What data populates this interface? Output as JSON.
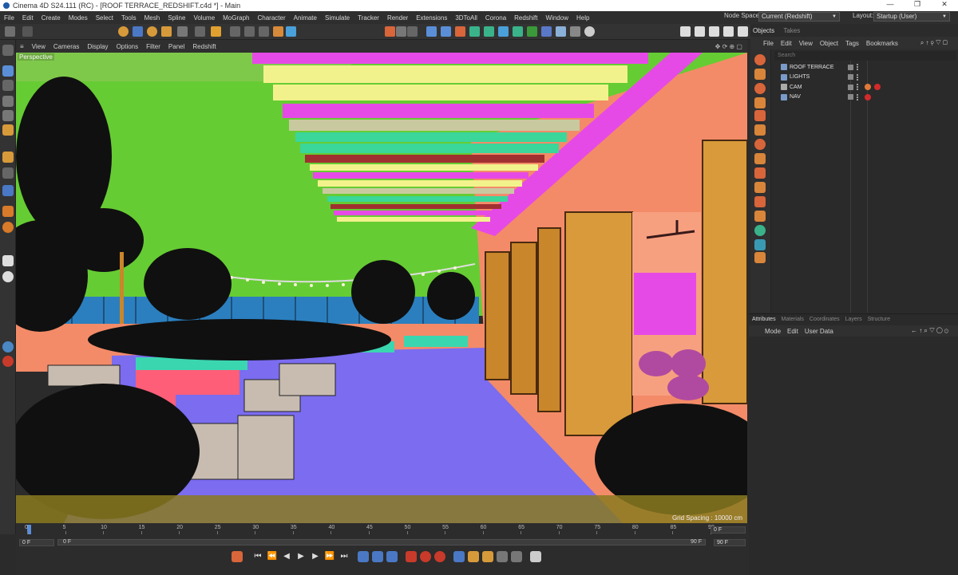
{
  "window": {
    "title": "Cinema 4D S24.111 (RC) - [ROOF TERRACE_REDSHIFT.c4d *] - Main",
    "controls": [
      "—",
      "❐",
      "✕"
    ]
  },
  "menubar": [
    "File",
    "Edit",
    "Create",
    "Modes",
    "Select",
    "Tools",
    "Mesh",
    "Spline",
    "Volume",
    "MoGraph",
    "Character",
    "Animate",
    "Simulate",
    "Tracker",
    "Render",
    "Extensions",
    "3DToAll",
    "Corona",
    "Redshift",
    "Window",
    "Help"
  ],
  "node_space": {
    "label": "Node Space:",
    "value": "Current (Redshift)"
  },
  "layout": {
    "label": "Layout:",
    "value": "Startup (User)"
  },
  "viewport": {
    "menu": [
      "View",
      "Cameras",
      "Display",
      "Options",
      "Filter",
      "Panel",
      "Redshift"
    ],
    "label": "Perspective",
    "grid_spacing": "Grid Spacing : 10000 cm"
  },
  "objects_panel": {
    "tabs": [
      "Objects",
      "Takes"
    ],
    "menu": [
      "File",
      "Edit",
      "View",
      "Object",
      "Tags",
      "Bookmarks"
    ],
    "search_placeholder": "Search",
    "items": [
      "ROOF TERRACE",
      "LIGHTS",
      "CAM",
      "NAV"
    ]
  },
  "attributes_panel": {
    "tabs": [
      "Attributes",
      "Materials",
      "Coordinates",
      "Layers",
      "Structure"
    ],
    "menu": [
      "Mode",
      "Edit",
      "User Data"
    ]
  },
  "timeline": {
    "ticks": [
      "0",
      "5",
      "10",
      "15",
      "20",
      "25",
      "30",
      "35",
      "40",
      "45",
      "50",
      "55",
      "60",
      "65",
      "70",
      "75",
      "80",
      "85",
      "90"
    ],
    "current_frame": "0 F",
    "start_frame": "0 F",
    "range_start": "0 F",
    "range_end": "90 F",
    "end_frame": "90 F"
  },
  "colors": {
    "sky": "#66cc33",
    "floor": "#7b6cf0",
    "wall": "#f38b68",
    "magenta": "#e64ae6",
    "accent_orange": "#f0a030",
    "panel_bg": "#2a2a2a"
  }
}
